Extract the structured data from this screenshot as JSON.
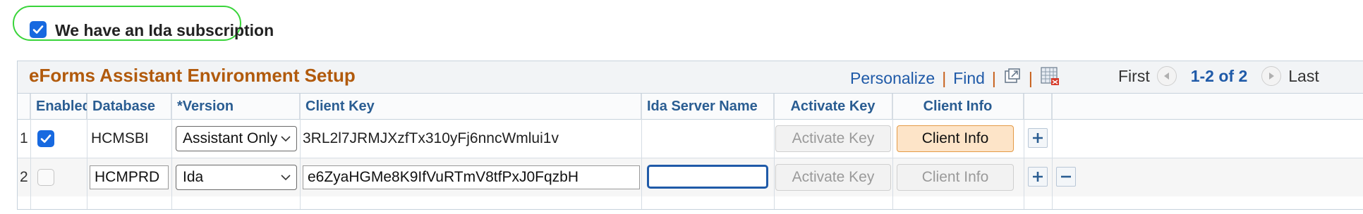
{
  "subscription": {
    "label": "We have an Ida subscription",
    "checked": true
  },
  "grid": {
    "title": "eForms Assistant Environment Setup",
    "links": {
      "personalize": "Personalize",
      "find": "Find"
    },
    "pager": {
      "first": "First",
      "range": "1-2 of 2",
      "last": "Last"
    },
    "columns": {
      "enabled": "Enabled",
      "database": "Database",
      "version": "*Version",
      "client_key": "Client Key",
      "ida_server_name": "Ida Server Name",
      "activate_key": "Activate Key",
      "client_info": "Client Info"
    },
    "rows": [
      {
        "num": "1",
        "enabled": true,
        "database": "HCMSBI",
        "version": "Assistant Only",
        "client_key": "3RL2l7JRMJXzfTx310yFj6nncWmlui1v",
        "ida_server_name": "",
        "activate_label": "Activate Key",
        "client_info_label": "Client Info"
      },
      {
        "num": "2",
        "enabled": false,
        "database": "HCMPRD",
        "version": "Ida",
        "client_key": "e6ZyaHGMe8K9IfVuRTmV8tfPxJ0FqzbH",
        "ida_server_name": "",
        "activate_label": "Activate Key",
        "client_info_label": "Client Info"
      }
    ]
  },
  "icons": {
    "checkbox_checked": "check-icon",
    "new_window": "new-window-icon",
    "download": "download-spreadsheet-icon",
    "pager_prev": "left-arrow-icon",
    "pager_next": "right-arrow-icon",
    "add_row": "plus-icon",
    "delete_row": "minus-icon",
    "dropdown": "chevron-down-icon"
  },
  "colors": {
    "title": "#b15a0c",
    "link": "#1f5aa8",
    "header_text": "#2a5d92",
    "highlight": "#39d43a",
    "checkbox": "#1769e0"
  }
}
